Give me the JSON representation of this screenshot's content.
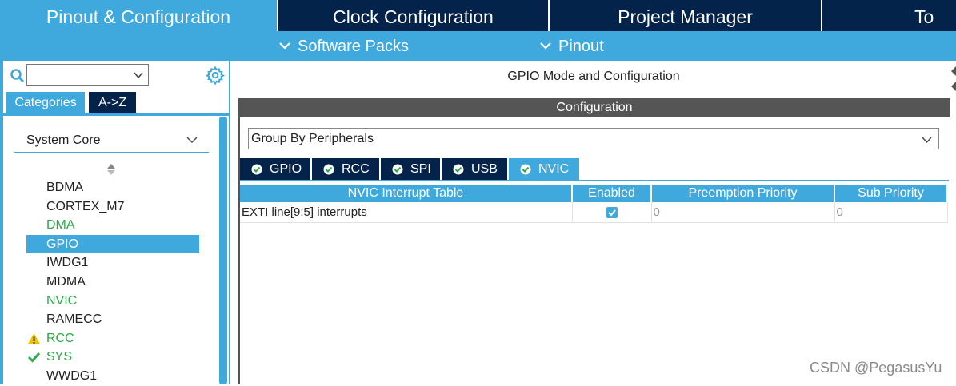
{
  "top_tabs": [
    {
      "label": "Pinout & Configuration",
      "active": true
    },
    {
      "label": "Clock Configuration",
      "active": false
    },
    {
      "label": "Project Manager",
      "active": false
    },
    {
      "label": "To",
      "active": false
    }
  ],
  "sub_menu": {
    "software_packs": "Software Packs",
    "pinout": "Pinout"
  },
  "left": {
    "search": {
      "value": "",
      "placeholder": ""
    },
    "tabs": {
      "categories": "Categories",
      "az": "A->Z"
    },
    "category_selected": "System Core",
    "items": [
      {
        "label": "BDMA",
        "status": "none"
      },
      {
        "label": "CORTEX_M7",
        "status": "none"
      },
      {
        "label": "DMA",
        "status": "green"
      },
      {
        "label": "GPIO",
        "status": "selected"
      },
      {
        "label": "IWDG1",
        "status": "none"
      },
      {
        "label": "MDMA",
        "status": "none"
      },
      {
        "label": "NVIC",
        "status": "green"
      },
      {
        "label": "RAMECC",
        "status": "none"
      },
      {
        "label": "RCC",
        "status": "warning"
      },
      {
        "label": "SYS",
        "status": "ok"
      },
      {
        "label": "WWDG1",
        "status": "none"
      }
    ]
  },
  "main": {
    "mode_title": "GPIO Mode and Configuration",
    "config_title": "Configuration",
    "group_by": "Group By Peripherals",
    "periph_tabs": [
      "GPIO",
      "RCC",
      "SPI",
      "USB",
      "NVIC"
    ],
    "active_periph_tab": "NVIC",
    "table": {
      "headers": [
        "NVIC Interrupt Table",
        "Enabled",
        "Preemption Priority",
        "Sub Priority"
      ],
      "rows": [
        {
          "name": "EXTI line[9:5] interrupts",
          "enabled": true,
          "preemption": "0",
          "sub": "0"
        }
      ]
    }
  },
  "watermark": "CSDN @PegasusYu",
  "colors": {
    "navy": "#03234b",
    "accent": "#3fa9dd",
    "green": "#2da84a",
    "warning": "#f2c200",
    "config_bar": "#555555"
  }
}
